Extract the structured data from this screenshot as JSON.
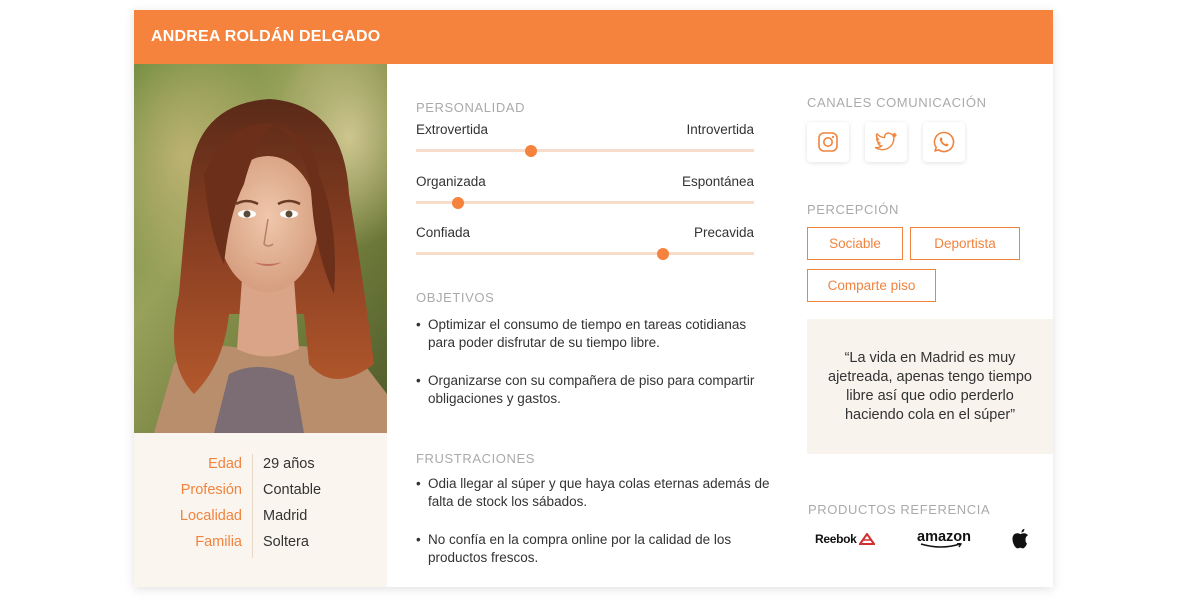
{
  "persona": {
    "name": "ANDREA ROLDÁN DELGADO",
    "facts": [
      {
        "key": "Edad",
        "value": "29 años"
      },
      {
        "key": "Profesión",
        "value": "Contable"
      },
      {
        "key": "Localidad",
        "value": "Madrid"
      },
      {
        "key": "Familia",
        "value": "Soltera"
      }
    ]
  },
  "personality": {
    "title": "PERSONALIDAD",
    "sliders": [
      {
        "left": "Extrovertida",
        "right": "Introvertida",
        "value": 0.34
      },
      {
        "left": "Organizada",
        "right": "Espontánea",
        "value": 0.125
      },
      {
        "left": "Confiada",
        "right": "Precavida",
        "value": 0.73
      }
    ]
  },
  "goals": {
    "title": "OBJETIVOS",
    "items": [
      "Optimizar el consumo de tiempo en tareas cotidianas para poder disfrutar de su tiempo libre.",
      "Organizarse con su compañera de piso para compartir obligaciones y gastos."
    ]
  },
  "frustrations": {
    "title": "FRUSTRACIONES",
    "items": [
      "Odia llegar al súper y que haya colas eternas además de falta de stock los sábados.",
      "No confía en la compra online por la calidad de los productos frescos."
    ]
  },
  "channels": {
    "title": "CANALES COMUNICACIÓN",
    "icons": [
      "instagram-icon",
      "twitter-icon",
      "whatsapp-icon"
    ]
  },
  "perception": {
    "title": "PERCEPCIÓN",
    "tags": [
      "Sociable",
      "Deportista",
      "Comparte piso"
    ]
  },
  "quote": "“La vida en Madrid es muy ajetreada, apenas tengo tiempo libre así que odio perderlo haciendo cola en el súper”",
  "products": {
    "title": "PRODUCTOS REFERENCIA",
    "brands": [
      "Reebok",
      "amazon",
      "apple-logo"
    ]
  },
  "colors": {
    "accent": "#f5833d",
    "track": "#f7dccb",
    "panel": "#faf5ef"
  }
}
